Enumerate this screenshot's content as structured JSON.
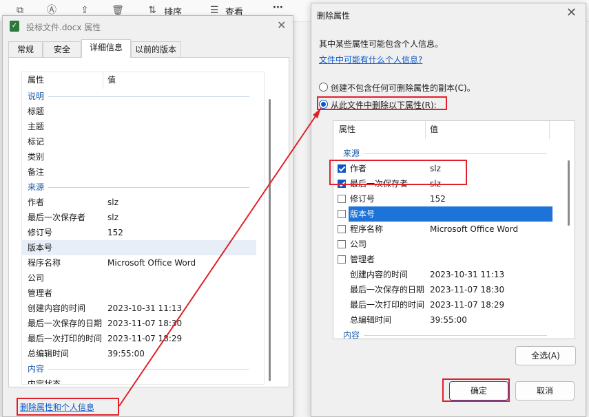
{
  "toolbar": {
    "sort_label": "排序",
    "view_label": "查看",
    "more_label": "···"
  },
  "props": {
    "title": "投标文件.docx 属性",
    "close": "✕",
    "tabs": [
      {
        "label": "常规"
      },
      {
        "label": "安全"
      },
      {
        "label": "详细信息"
      },
      {
        "label": "以前的版本"
      }
    ],
    "header": {
      "name": "属性",
      "value": "值"
    },
    "rows": [
      {
        "name": "说明",
        "value": "",
        "group": true
      },
      {
        "name": "标题",
        "value": ""
      },
      {
        "name": "主题",
        "value": ""
      },
      {
        "name": "标记",
        "value": ""
      },
      {
        "name": "类别",
        "value": ""
      },
      {
        "name": "备注",
        "value": ""
      },
      {
        "name": "来源",
        "value": "",
        "group": true
      },
      {
        "name": "作者",
        "value": "slz"
      },
      {
        "name": "最后一次保存者",
        "value": "slz"
      },
      {
        "name": "修订号",
        "value": "152"
      },
      {
        "name": "版本号",
        "value": ""
      },
      {
        "name": "程序名称",
        "value": "Microsoft Office Word"
      },
      {
        "name": "公司",
        "value": ""
      },
      {
        "name": "管理者",
        "value": ""
      },
      {
        "name": "创建内容的时间",
        "value": "2023-10-31 11:13"
      },
      {
        "name": "最后一次保存的日期",
        "value": "2023-11-07 18:30"
      },
      {
        "name": "最后一次打印的时间",
        "value": "2023-11-07 18:29"
      },
      {
        "name": "总编辑时间",
        "value": "39:55:00"
      },
      {
        "name": "内容",
        "value": "",
        "group": true
      },
      {
        "name": "内容状态",
        "value": ""
      }
    ],
    "remove_link": "删除属性和个人信息"
  },
  "remove": {
    "title": "删除属性",
    "close": "✕",
    "info": "其中某些属性可能包含个人信息。",
    "link": "文件中可能有什么个人信息?",
    "option_copy": "创建不包含任何可删除属性的副本(C)。",
    "option_remove": "从此文件中删除以下属性(R):",
    "header": {
      "name": "属性",
      "value": "值"
    },
    "rows": [
      {
        "name": "来源",
        "value": "",
        "group": true
      },
      {
        "name": "作者",
        "value": "slz",
        "check": true,
        "checked": true
      },
      {
        "name": "最后一次保存者",
        "value": "slz",
        "check": true,
        "checked": true
      },
      {
        "name": "修订号",
        "value": "152",
        "check": true,
        "checked": false
      },
      {
        "name": "版本号",
        "value": "",
        "check": true,
        "checked": false,
        "selected": true
      },
      {
        "name": "程序名称",
        "value": "Microsoft Office Word",
        "check": true,
        "checked": false
      },
      {
        "name": "公司",
        "value": "",
        "check": true,
        "checked": false
      },
      {
        "name": "管理者",
        "value": "",
        "check": true,
        "checked": false
      },
      {
        "name": "创建内容的时间",
        "value": "2023-10-31 11:13",
        "check": false
      },
      {
        "name": "最后一次保存的日期",
        "value": "2023-11-07 18:30",
        "check": false
      },
      {
        "name": "最后一次打印的时间",
        "value": "2023-11-07 18:29",
        "check": false
      },
      {
        "name": "总编辑时间",
        "value": "39:55:00",
        "check": false
      },
      {
        "name": "内容",
        "value": "",
        "group": true
      }
    ],
    "select_all": "全选(A)",
    "ok": "确定",
    "cancel": "取消"
  }
}
